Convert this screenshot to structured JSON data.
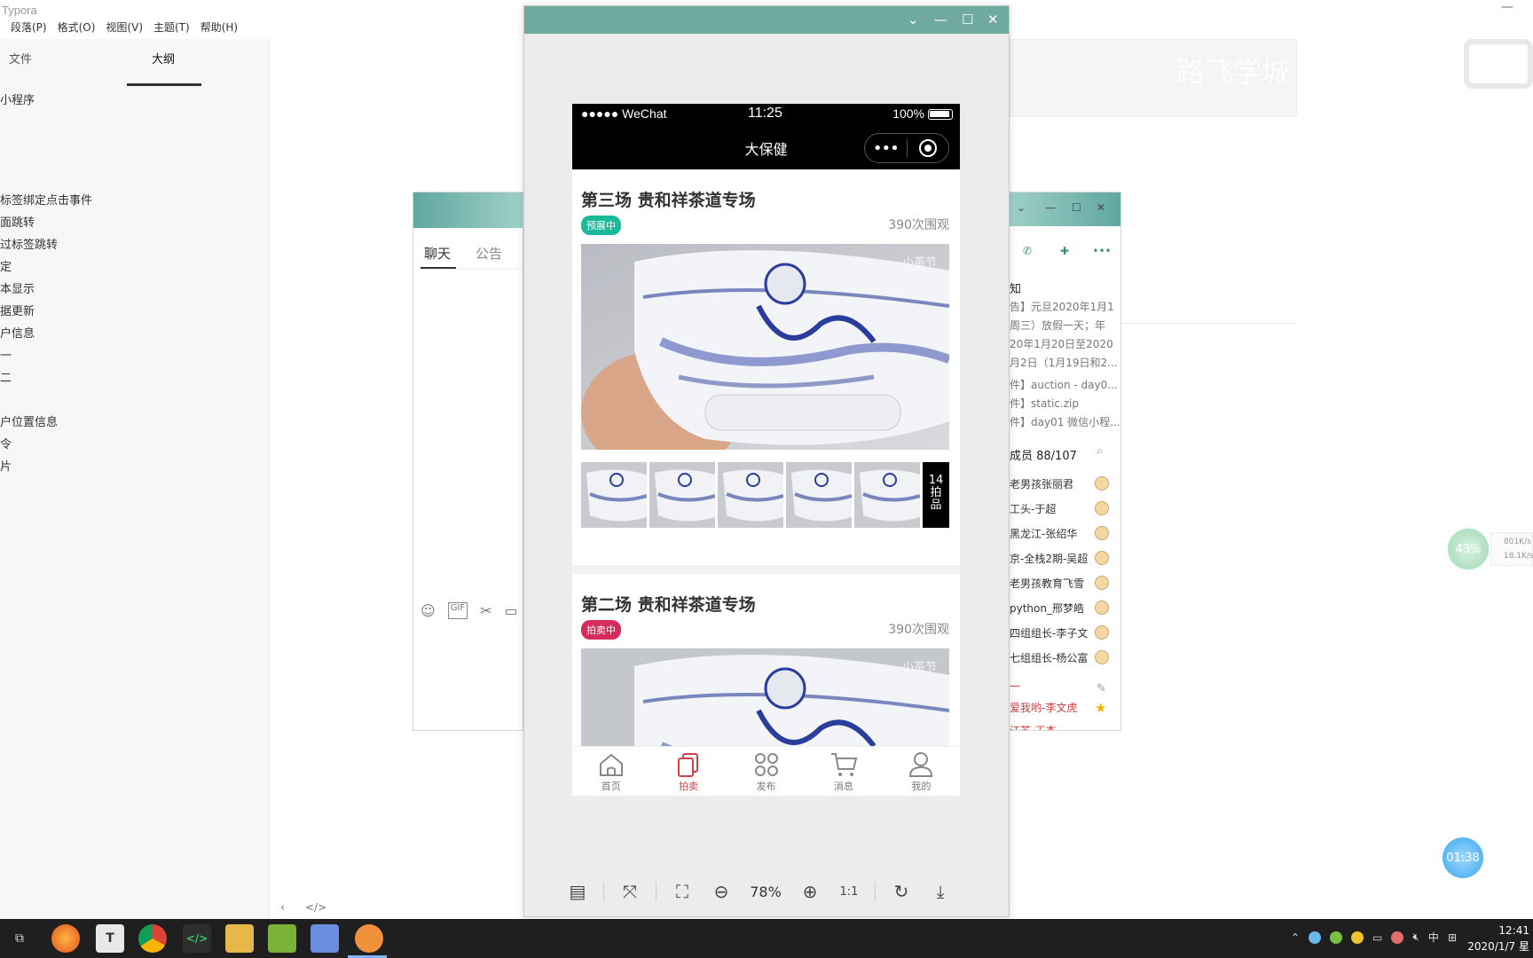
{
  "typora": {
    "app_title": "Typora",
    "menu": [
      "段落(P)",
      "格式(O)",
      "视图(V)",
      "主题(T)",
      "帮助(H)"
    ],
    "sidebar_tabs": [
      "文件",
      "大纲"
    ],
    "outline": [
      "小程序",
      "标签绑定点击事件",
      "面跳转",
      "过标签跳转",
      "定",
      "本显示",
      "据更新",
      "户信息",
      "一",
      "二",
      "户位置信息",
      "令",
      "片"
    ],
    "watermark": "路飞学城"
  },
  "qq_chat": {
    "tabs": [
      "聊天",
      "公告"
    ]
  },
  "qq_group": {
    "notice_title": "知",
    "notice_lines": [
      "告】元旦2020年1月1",
      "周三）放假一天；年",
      "20年1月20日至2020",
      "月2日（1月19日和2..."
    ],
    "file_lines": [
      "件】auction - day0...",
      "件】static.zip",
      "件】day01 微信小程..."
    ],
    "member_header": "成员 88/107",
    "members": [
      "老男孩张丽君",
      "工头-于超",
      "黑龙江-张绍华",
      "京-全栈2期-吴超",
      "老男孩教育飞雪",
      "python_邢梦皓",
      "四组组长-李子文",
      "七组组长-杨公富",
      "一",
      "爱我哟-李文虎",
      "江苏-王杰"
    ]
  },
  "widgets": {
    "speed_percent": "43%",
    "speed_up": "801K/s",
    "speed_down": "18.1K/s",
    "timer": "01:38"
  },
  "simulator": {
    "zoom": "78%",
    "status_bar": {
      "carrier": "●●●●● WeChat",
      "time": "11:25",
      "battery": "100%"
    },
    "nav_title": "大保健",
    "cards": [
      {
        "title": "第三场 贵和祥茶道专场",
        "badge": "预展中",
        "views": "390次围观",
        "watermark": "小茶节",
        "lots_num": "14",
        "lots_text": "拍品"
      },
      {
        "title": "第二场 贵和祥茶道专场",
        "badge": "拍卖中",
        "views": "390次围观",
        "watermark": "小茶节"
      }
    ],
    "tabbar": [
      "首页",
      "拍卖",
      "发布",
      "消息",
      "我的"
    ],
    "active_tab": "拍卖"
  },
  "taskbar": {
    "ime": "中",
    "time": "12:41",
    "date": "2020/1/7 星"
  },
  "colors": {
    "accent_teal": "#6fa9a1",
    "badge_green": "#19b99a",
    "badge_red": "#d62b5b",
    "tab_active": "#d0424e"
  }
}
